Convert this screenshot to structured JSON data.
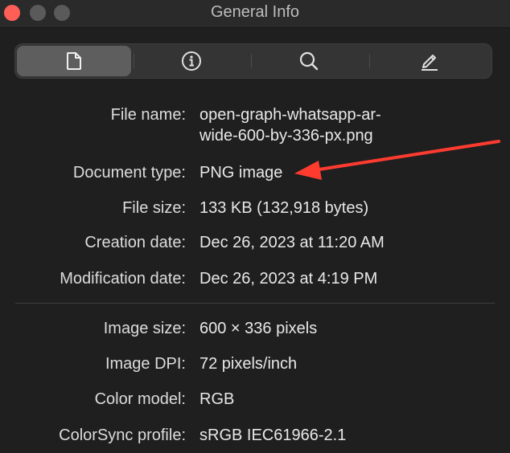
{
  "window": {
    "title": "General Info"
  },
  "toolbar": {
    "segments": [
      {
        "icon": "document-icon",
        "active": true
      },
      {
        "icon": "info-icon",
        "active": false
      },
      {
        "icon": "search-icon",
        "active": false
      },
      {
        "icon": "pencil-icon",
        "active": false
      }
    ]
  },
  "general": {
    "file_name_label": "File name:",
    "file_name_line1": "open-graph-whatsapp-ar-",
    "file_name_line2": "wide-600-by-336-px.png",
    "document_type_label": "Document type:",
    "document_type": "PNG image",
    "file_size_label": "File size:",
    "file_size": "133 KB (132,918 bytes)",
    "creation_date_label": "Creation date:",
    "creation_date": "Dec 26, 2023 at 11:20 AM",
    "modification_date_label": "Modification date:",
    "modification_date": "Dec 26, 2023 at 4:19 PM"
  },
  "image": {
    "image_size_label": "Image size:",
    "image_size": "600 × 336 pixels",
    "image_dpi_label": "Image DPI:",
    "image_dpi": "72 pixels/inch",
    "color_model_label": "Color model:",
    "color_model": "RGB",
    "colorsync_profile_label": "ColorSync profile:",
    "colorsync_profile": "sRGB IEC61966-2.1"
  },
  "colors": {
    "background": "#1f1f1f",
    "annotation_arrow": "#ff3b30",
    "close_button": "#ff5f57"
  }
}
